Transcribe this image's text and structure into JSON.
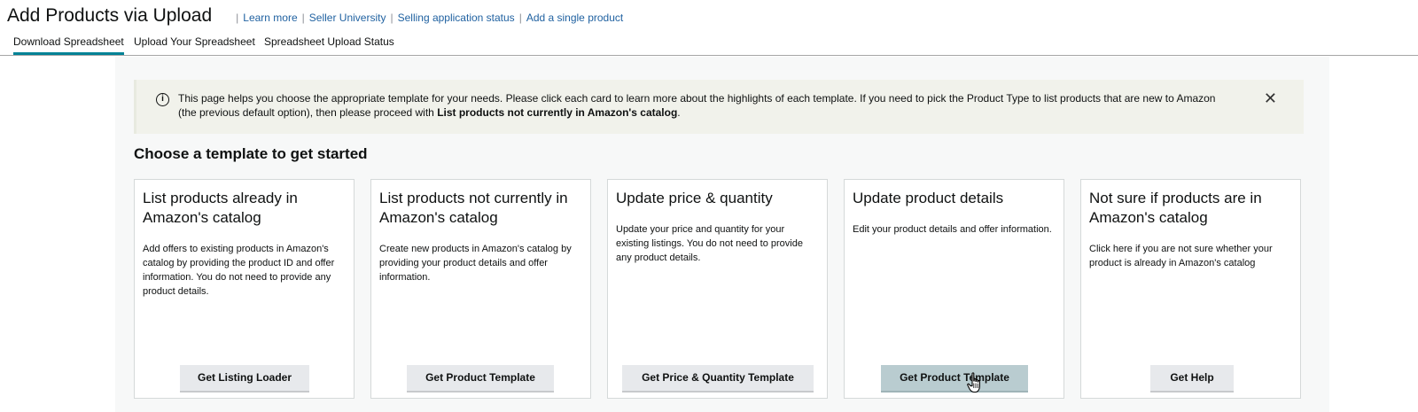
{
  "header": {
    "title": "Add Products via Upload",
    "links": [
      "Learn more",
      "Seller University",
      "Selling application status",
      "Add a single product"
    ]
  },
  "tabs": [
    {
      "label": "Download Spreadsheet",
      "active": true
    },
    {
      "label": "Upload Your Spreadsheet",
      "active": false
    },
    {
      "label": "Spreadsheet Upload Status",
      "active": false
    }
  ],
  "alert": {
    "text_before": "This page helps you choose the appropriate template for your needs. Please click each card to learn more about the highlights of each template. If you need to pick the Product Type to list products that are new to Amazon (the previous default option), then please proceed with ",
    "text_bold": "List products not currently in Amazon's catalog",
    "text_after": "."
  },
  "section_title": "Choose a template to get started",
  "cards": [
    {
      "title": "List products already in Amazon's catalog",
      "description": "Add offers to existing products in Amazon's catalog by providing the product ID and offer information. You do not need to provide any product details.",
      "button": "Get Listing Loader"
    },
    {
      "title": "List products not currently in Amazon's catalog",
      "description": "Create new products in Amazon's catalog by providing your product details and offer information.",
      "button": "Get Product Template"
    },
    {
      "title": "Update price & quantity",
      "description": "Update your price and quantity for your existing listings. You do not need to provide any product details.",
      "button": "Get Price & Quantity Template"
    },
    {
      "title": "Update product details",
      "description": "Edit your product details and offer information.",
      "button": "Get Product Template"
    },
    {
      "title": "Not sure if products are in Amazon's catalog",
      "description": "Click here if you are not sure whether your product is already in Amazon's catalog",
      "button": "Get Help"
    }
  ],
  "colors": {
    "link": "#2162a1",
    "tab_active_underline": "#008296",
    "alert_bg": "#f1f2eb",
    "button_bg": "#e7e9ec",
    "button_hover_bg": "#b9ccd0"
  },
  "icons": {
    "alert": "info-icon",
    "close": "close-icon",
    "cursor": "hand-pointer-icon"
  }
}
